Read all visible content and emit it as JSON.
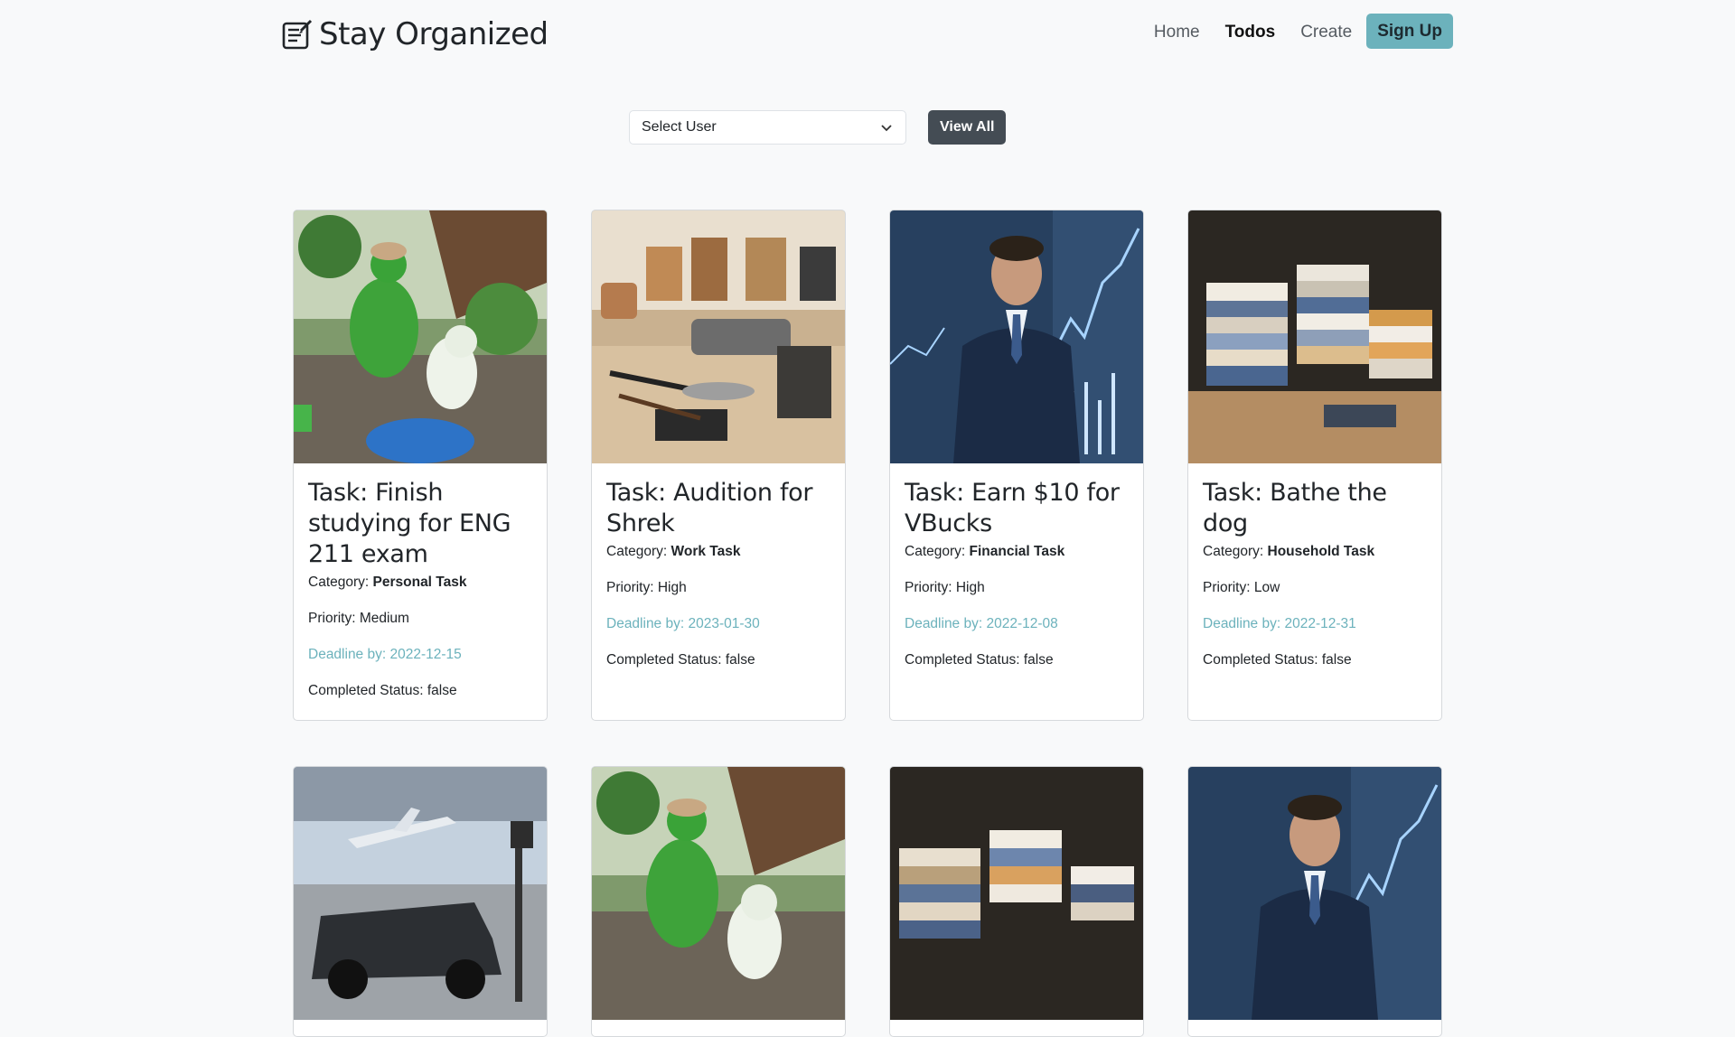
{
  "brand": {
    "name": "Stay Organized"
  },
  "nav": {
    "home": "Home",
    "todos": "Todos",
    "create": "Create",
    "signup": "Sign Up"
  },
  "filter": {
    "select_placeholder": "Select User",
    "view_all": "View All"
  },
  "cards": [
    {
      "title": "Task: Finish studying for ENG 211 exam",
      "category_label": "Category: ",
      "category": "Personal Task",
      "priority": "Priority: Medium",
      "deadline": "Deadline by: 2022-12-15",
      "status": "Completed Status: false",
      "image": "green-man-dog"
    },
    {
      "title": "Task: Audition for Shrek",
      "category_label": "Category: ",
      "category": "Work Task",
      "priority": "Priority: High",
      "deadline": "Deadline by: 2023-01-30",
      "status": "Completed Status: false",
      "image": "office-supplies"
    },
    {
      "title": "Task: Earn $10 for VBucks",
      "category_label": "Category: ",
      "category": "Financial Task",
      "priority": "Priority: High",
      "deadline": "Deadline by: 2022-12-08",
      "status": "Completed Status: false",
      "image": "businessman"
    },
    {
      "title": "Task: Bathe the dog",
      "category_label": "Category: ",
      "category": "Household Task",
      "priority": "Priority: Low",
      "deadline": "Deadline by: 2022-12-31",
      "status": "Completed Status: false",
      "image": "folded-clothes"
    }
  ],
  "row2_images": [
    "airport-car",
    "green-man-dog",
    "folded-clothes",
    "businessman"
  ],
  "colors": {
    "accent": "#6cb2bc",
    "dark_button": "#444c54",
    "background": "#f8f9fa"
  }
}
